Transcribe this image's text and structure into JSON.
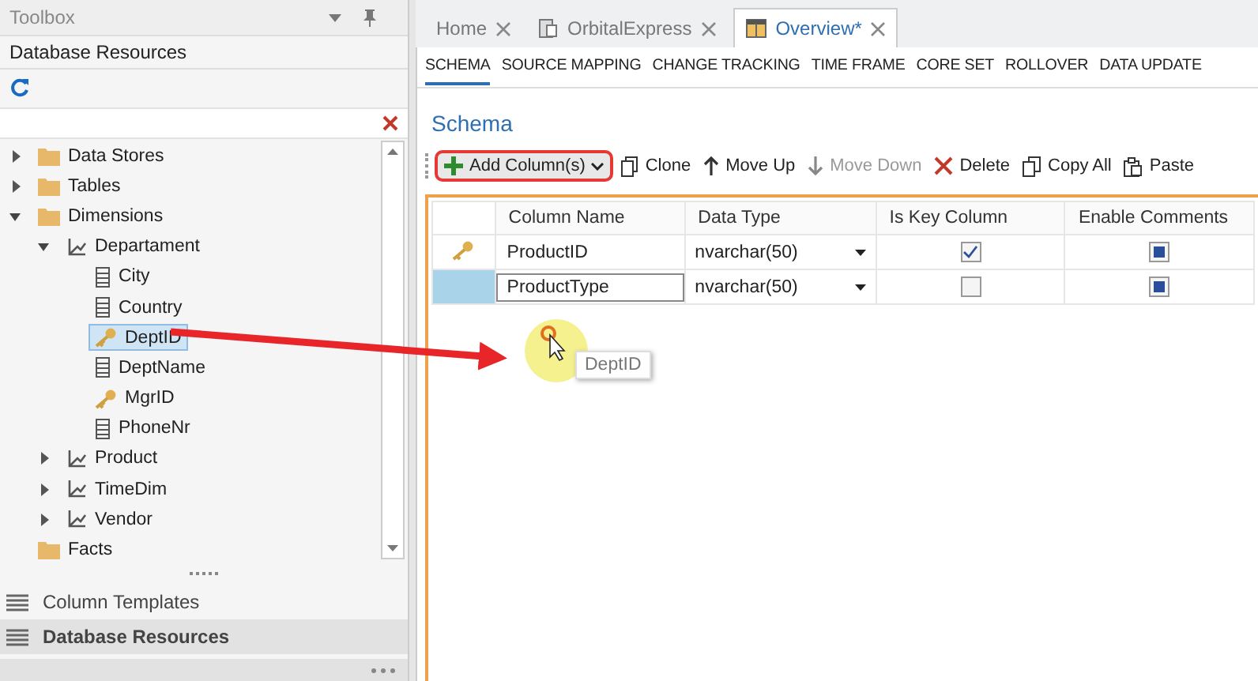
{
  "toolbox": {
    "title": "Toolbox",
    "panel_title": "Database Resources",
    "tree": [
      {
        "label": "Data Stores",
        "kind": "folder",
        "expanded": false,
        "selected": false
      },
      {
        "label": "Tables",
        "kind": "folder",
        "expanded": false,
        "selected": false
      },
      {
        "label": "Dimensions",
        "kind": "folder",
        "expanded": true,
        "selected": false,
        "children": [
          {
            "label": "Departament",
            "kind": "dimension",
            "expanded": true,
            "selected": false,
            "children": [
              {
                "label": "City",
                "kind": "column",
                "selected": false
              },
              {
                "label": "Country",
                "kind": "column",
                "selected": false
              },
              {
                "label": "DeptID",
                "kind": "key",
                "selected": true
              },
              {
                "label": "DeptName",
                "kind": "column",
                "selected": false
              },
              {
                "label": "MgrID",
                "kind": "key",
                "selected": false
              },
              {
                "label": "PhoneNr",
                "kind": "column",
                "selected": false
              }
            ]
          },
          {
            "label": "Product",
            "kind": "dimension",
            "expanded": false,
            "selected": false
          },
          {
            "label": "TimeDim",
            "kind": "dimension",
            "expanded": false,
            "selected": false
          },
          {
            "label": "Vendor",
            "kind": "dimension",
            "expanded": false,
            "selected": false
          }
        ]
      },
      {
        "label": "Facts",
        "kind": "folder",
        "selected": false
      }
    ],
    "sections": [
      {
        "label": "Column Templates",
        "selected": false
      },
      {
        "label": "Database Resources",
        "selected": true
      }
    ]
  },
  "tabs": [
    {
      "label": "Home",
      "kind": "plain",
      "selected": false
    },
    {
      "label": "OrbitalExpress",
      "kind": "document",
      "selected": false
    },
    {
      "label": "Overview*",
      "kind": "overview",
      "selected": true
    }
  ],
  "subnav": [
    {
      "label": "SCHEMA",
      "selected": true
    },
    {
      "label": "SOURCE MAPPING",
      "selected": false
    },
    {
      "label": "CHANGE TRACKING",
      "selected": false
    },
    {
      "label": "TIME FRAME",
      "selected": false
    },
    {
      "label": "CORE SET",
      "selected": false
    },
    {
      "label": "ROLLOVER",
      "selected": false
    },
    {
      "label": "DATA UPDATE",
      "selected": false
    }
  ],
  "section_title": "Schema",
  "toolbar": [
    {
      "label": "Add Column(s)",
      "kind": "add",
      "disabled": false,
      "highlighted": true
    },
    {
      "label": "Clone",
      "kind": "clone",
      "disabled": false,
      "highlighted": false
    },
    {
      "label": "Move Up",
      "kind": "up",
      "disabled": false,
      "highlighted": false
    },
    {
      "label": "Move Down",
      "kind": "down",
      "disabled": true,
      "highlighted": false
    },
    {
      "label": "Delete",
      "kind": "delete",
      "disabled": false,
      "highlighted": false
    },
    {
      "label": "Copy All",
      "kind": "copy",
      "disabled": false,
      "highlighted": false
    },
    {
      "label": "Paste",
      "kind": "paste",
      "disabled": false,
      "highlighted": false
    }
  ],
  "grid": {
    "columns": [
      "Column Name",
      "Data Type",
      "Is Key Column",
      "Enable Comments"
    ],
    "rows": [
      {
        "key": true,
        "selected": false,
        "name": "ProductID",
        "data_type": "nvarchar(50)",
        "is_key": true,
        "enable_comments": true
      },
      {
        "key": false,
        "selected": true,
        "name": "ProductType",
        "data_type": "nvarchar(50)",
        "is_key": false,
        "enable_comments": true
      }
    ]
  },
  "drag_ghost": {
    "label": "DeptID"
  }
}
